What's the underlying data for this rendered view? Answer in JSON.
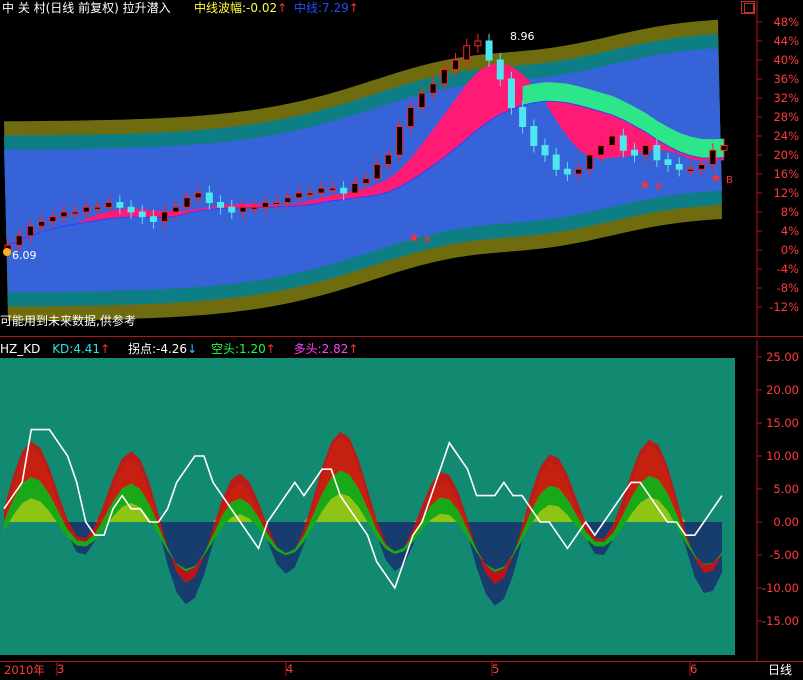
{
  "top_header": {
    "title": "中 关 村(日线 前复权) 拉升潜入",
    "wave_label": "中线波幅:",
    "wave_value": "-0.02",
    "wave_arrow": "↑",
    "mid_label": "中线:",
    "mid_value": "7.29",
    "mid_arrow": "↑",
    "close_icon": "close-icon"
  },
  "top_notes": {
    "high_label": "8.96",
    "low_label": "6.09",
    "footnote": "可能用到未来数据,供参考",
    "signal_b": "B"
  },
  "bottom_header": {
    "name": "HZ_KD",
    "kd_label": "KD:",
    "kd_value": "4.41",
    "kd_arrow": "↑",
    "turn_label": "拐点:",
    "turn_value": "-4.26",
    "turn_arrow": "↓",
    "bear_label": "空头:",
    "bear_value": "1.20",
    "bear_arrow": "↑",
    "bull_label": "多头:",
    "bull_value": "2.82",
    "bull_arrow": "↑"
  },
  "x_axis": {
    "labels": [
      "2010年",
      "3",
      "4",
      "5",
      "6"
    ],
    "period_button": "日线"
  },
  "colors": {
    "background": "#000000",
    "panel_bg": "#128a72",
    "band_outer": "#6f6c10",
    "band_mid": "#0d7f84",
    "band_inner": "#3663d8",
    "pink_fill": "#ff1a76",
    "green_fill": "#2ee68a",
    "up_candle": "#ff2020",
    "down_candle": "#4fe6ef",
    "axis": "#b01818",
    "kd_line": "#ffffff",
    "bull_area": "#8ec414",
    "bear_area": "#173c6e",
    "red_area": "#cc1010",
    "green_area": "#18a818"
  },
  "chart_data": [
    {
      "type": "candlestick",
      "title": "中 关 村(日线 前复权) 拉升潜入",
      "y_axis_labels": [
        "48%",
        "44%",
        "40%",
        "36%",
        "32%",
        "28%",
        "24%",
        "20%",
        "16%",
        "12%",
        "8%",
        "4%",
        "0%",
        "-4%",
        "-8%",
        "-12%"
      ],
      "ylim_percent": [
        -14,
        50
      ],
      "base_price": 6.09,
      "annotations": [
        {
          "text": "8.96",
          "kind": "high"
        },
        {
          "text": "6.09",
          "kind": "low"
        },
        {
          "text": "B",
          "kind": "buy-signal"
        }
      ],
      "series": [
        {
          "name": "close_percent",
          "values": [
            1,
            3,
            5,
            6,
            7,
            8,
            8,
            9,
            9,
            10,
            9,
            8,
            7,
            6,
            8,
            9,
            11,
            12,
            10,
            9,
            8,
            9,
            9,
            10,
            10,
            11,
            12,
            12,
            13,
            13,
            12,
            14,
            15,
            18,
            20,
            26,
            30,
            33,
            35,
            38,
            40,
            43,
            44,
            40,
            36,
            30,
            26,
            22,
            20,
            17,
            16,
            17,
            20,
            22,
            24,
            21,
            20,
            22,
            19,
            18,
            17,
            17,
            18,
            21,
            22
          ]
        }
      ]
    },
    {
      "type": "area",
      "title": "HZ_KD",
      "y_axis_labels": [
        "25.00",
        "20.00",
        "15.00",
        "10.00",
        "5.00",
        "0.00",
        "-5.00",
        "-10.00",
        "-15.00"
      ],
      "ylim": [
        -20,
        25
      ],
      "series": [
        {
          "name": "KD",
          "last": 4.41,
          "values": [
            2,
            4,
            6,
            13,
            14,
            13,
            11,
            9,
            5,
            0,
            -3,
            -3,
            2,
            3,
            2,
            1,
            0,
            -1,
            2,
            5,
            8,
            10,
            9,
            6,
            3,
            1,
            -1,
            -3,
            -4,
            -1,
            1,
            4,
            5,
            3,
            6,
            8,
            7,
            4,
            2,
            0,
            -3,
            -6,
            -8,
            -10,
            -6,
            -3,
            -1,
            3,
            8,
            12,
            10,
            7,
            4,
            3,
            4,
            5,
            4,
            3,
            1,
            0,
            -1,
            -3,
            -4,
            -2,
            0,
            -2,
            -1,
            1,
            3,
            5,
            6,
            4,
            2,
            0,
            -1,
            -3,
            -2,
            0,
            2,
            4
          ]
        },
        {
          "name": "拐点",
          "last": -4.26
        },
        {
          "name": "空头",
          "last": 1.2
        },
        {
          "name": "多头",
          "last": 2.82
        }
      ]
    }
  ]
}
